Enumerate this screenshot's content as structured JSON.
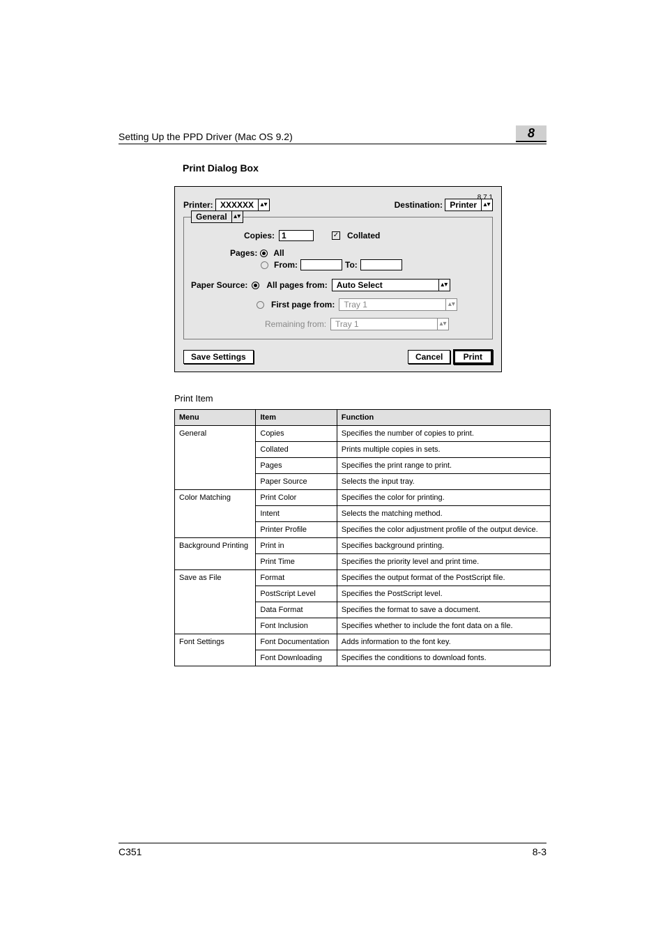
{
  "header": {
    "running": "Setting Up the PPD Driver (Mac OS 9.2)",
    "chapter": "8"
  },
  "section_title": "Print Dialog Box",
  "dialog": {
    "version": "8.7.1",
    "printer_label": "Printer:",
    "printer_value": "XXXXXX",
    "destination_label": "Destination:",
    "destination_value": "Printer",
    "panel_selector": "General",
    "copies_label": "Copies:",
    "copies_value": "1",
    "collated_label": "Collated",
    "pages_label": "Pages:",
    "pages_all": "All",
    "pages_from_label": "From:",
    "pages_to_label": "To:",
    "paper_source_label": "Paper Source:",
    "all_pages_from_label": "All pages from:",
    "all_pages_from_value": "Auto Select",
    "first_page_from_label": "First page from:",
    "first_page_from_value": "Tray 1",
    "remaining_from_label": "Remaining from:",
    "remaining_from_value": "Tray 1",
    "save_settings": "Save Settings",
    "cancel": "Cancel",
    "print": "Print"
  },
  "item_caption": "Print Item",
  "table": {
    "head": {
      "menu": "Menu",
      "item": "Item",
      "function": "Function"
    },
    "rows": [
      {
        "menu": "General",
        "menu_rowspan": 4,
        "item": "Copies",
        "func": "Specifies the number of copies to print."
      },
      {
        "item": "Collated",
        "func": "Prints multiple copies in sets."
      },
      {
        "item": "Pages",
        "func": "Specifies the print range to print."
      },
      {
        "item": "Paper Source",
        "func": "Selects the input tray."
      },
      {
        "menu": "Color Matching",
        "menu_rowspan": 3,
        "item": "Print Color",
        "func": "Specifies the color for printing."
      },
      {
        "item": "Intent",
        "func": "Selects the matching method."
      },
      {
        "item": "Printer Profile",
        "func": "Specifies the color adjustment profile of the output device."
      },
      {
        "menu": "Background Printing",
        "menu_rowspan": 2,
        "item": "Print in",
        "func": "Specifies background printing."
      },
      {
        "item": "Print Time",
        "func": "Specifies the priority level and print time."
      },
      {
        "menu": "Save as File",
        "menu_rowspan": 4,
        "item": "Format",
        "func": "Specifies the output format of the PostScript file."
      },
      {
        "item": "PostScript Level",
        "func": "Specifies the PostScript level."
      },
      {
        "item": "Data Format",
        "func": "Specifies the format to save a document."
      },
      {
        "item": "Font Inclusion",
        "func": "Specifies whether to include the font data on a file."
      },
      {
        "menu": "Font Settings",
        "menu_rowspan": 2,
        "item": "Font Documentation",
        "func": "Adds information to the font key."
      },
      {
        "item": "Font Downloading",
        "func": "Specifies the conditions to download fonts."
      }
    ]
  },
  "footer": {
    "model": "C351",
    "page": "8-3"
  }
}
